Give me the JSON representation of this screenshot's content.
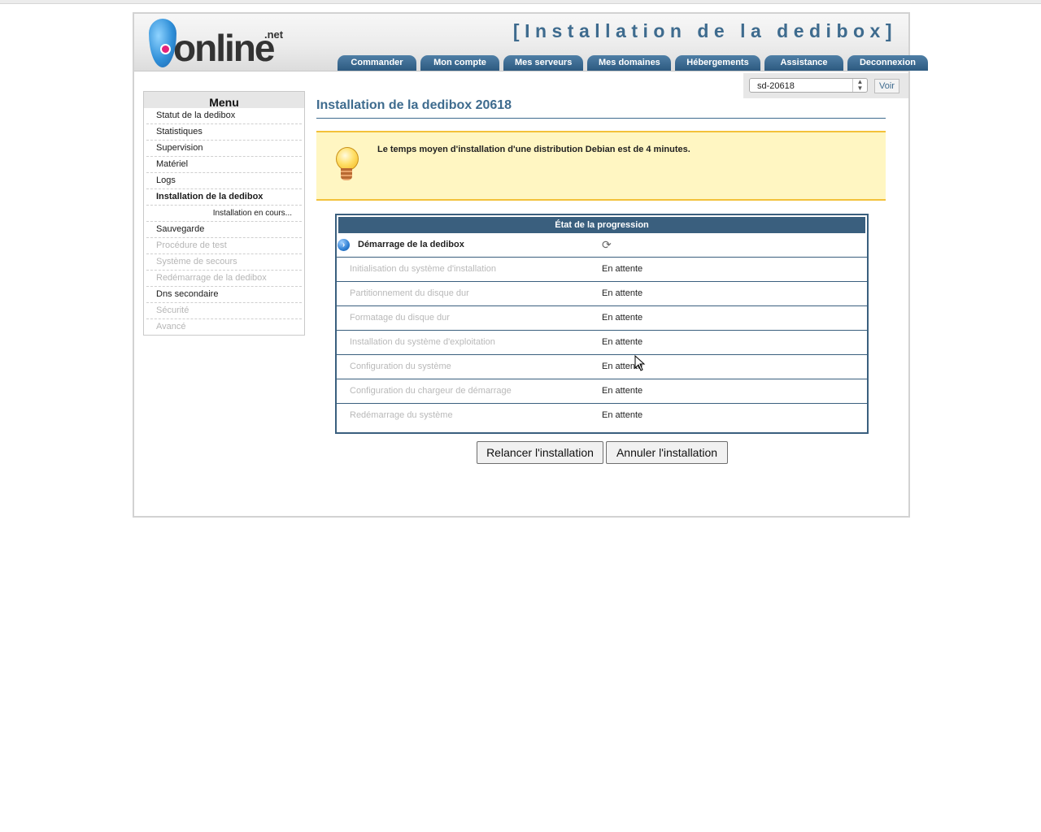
{
  "header": {
    "logo_text": "online",
    "logo_suffix": ".net",
    "page_heading": "[Installation de la dedibox]",
    "tabs": [
      "Commander",
      "Mon compte",
      "Mes serveurs",
      "Mes domaines",
      "Hébergements",
      "Assistance",
      "Deconnexion"
    ]
  },
  "server_selector": {
    "selected": "sd-20618",
    "button": "Voir"
  },
  "menu": {
    "title": "Menu",
    "items": [
      {
        "label": "Statut de la dedibox",
        "state": "normal"
      },
      {
        "label": "Statistiques",
        "state": "normal"
      },
      {
        "label": "Supervision",
        "state": "normal"
      },
      {
        "label": "Matériel",
        "state": "normal"
      },
      {
        "label": "Logs",
        "state": "normal"
      },
      {
        "label": "Installation de la dedibox",
        "state": "active"
      },
      {
        "label": "Installation en cours...",
        "state": "sub"
      },
      {
        "label": "Sauvegarde",
        "state": "normal"
      },
      {
        "label": "Procédure de test",
        "state": "disabled"
      },
      {
        "label": "Système de secours",
        "state": "disabled"
      },
      {
        "label": "Redémarrage de la dedibox",
        "state": "disabled"
      },
      {
        "label": "Dns secondaire",
        "state": "normal"
      },
      {
        "label": "Sécurité",
        "state": "disabled"
      },
      {
        "label": "Avancé",
        "state": "disabled"
      }
    ]
  },
  "main": {
    "title": "Installation de la dedibox 20618",
    "tip": "Le temps moyen d'installation d'une distribution Debian est de 4 minutes.",
    "progress": {
      "header": "État de la progression",
      "steps": [
        {
          "label": "Démarrage de la dedibox",
          "status": "",
          "current": true
        },
        {
          "label": "Initialisation du système d'installation",
          "status": "En attente"
        },
        {
          "label": "Partitionnement du disque dur",
          "status": "En attente"
        },
        {
          "label": "Formatage du disque dur",
          "status": "En attente"
        },
        {
          "label": "Installation du système d'exploitation",
          "status": "En attente"
        },
        {
          "label": "Configuration du système",
          "status": "En attente"
        },
        {
          "label": "Configuration du chargeur de démarrage",
          "status": "En attente"
        },
        {
          "label": "Redémarrage du système",
          "status": "En attente"
        }
      ]
    },
    "buttons": {
      "relaunch": "Relancer l'installation",
      "cancel": "Annuler l'installation"
    }
  },
  "colors": {
    "accent": "#3e6b8e",
    "table_header": "#3a5f7e",
    "tip_background": "#fff6c2",
    "tip_border": "#f3c13a"
  }
}
